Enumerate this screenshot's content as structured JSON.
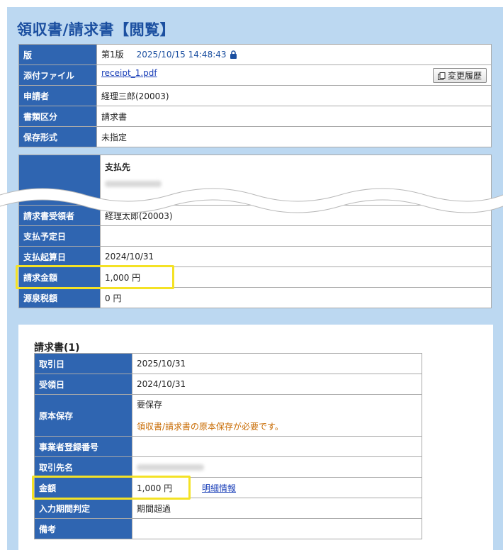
{
  "header": {
    "title": "領収書/請求書【閲覧】"
  },
  "summary": {
    "version_label": "版",
    "version_value": "第1版",
    "version_datetime": "2025/10/15 14:48:43",
    "attachment_label": "添付ファイル",
    "attachment_file": "receipt_1.pdf",
    "history_button": "変更履歴",
    "applicant_label": "申請者",
    "applicant_value": "経理三郎(20003)",
    "doctype_label": "書類区分",
    "doctype_value": "請求書",
    "storage_label": "保存形式",
    "storage_value": "未指定"
  },
  "payment": {
    "payee_heading": "支払先",
    "receiver_label": "請求書受領者",
    "receiver_value": "経理太郎(20003)",
    "scheduled_label": "支払予定日",
    "scheduled_value": "",
    "base_date_label": "支払起算日",
    "base_date_value": "2024/10/31",
    "amount_label": "請求金額",
    "amount_value": "1,000 円",
    "withholding_label": "源泉税額",
    "withholding_value": "0 円"
  },
  "invoice": {
    "section_title": "請求書(1)",
    "txn_date_label": "取引日",
    "txn_date_value": "2025/10/31",
    "recv_date_label": "受領日",
    "recv_date_value": "2024/10/31",
    "original_label": "原本保存",
    "original_value": "要保存",
    "original_note": "領収書/請求書の原本保存が必要です。",
    "reg_no_label": "事業者登録番号",
    "reg_no_value": "",
    "partner_label": "取引先名",
    "amount_label": "金額",
    "amount_value": "1,000 円",
    "detail_link": "明細情報",
    "period_label": "入力期間判定",
    "period_value": "期間超過",
    "remarks_label": "備考",
    "remarks_value": ""
  },
  "colors": {
    "header_cell": "#2f65b1",
    "panel": "#bcd8f1",
    "highlight": "#f4e225",
    "warning": "#c86a00"
  }
}
